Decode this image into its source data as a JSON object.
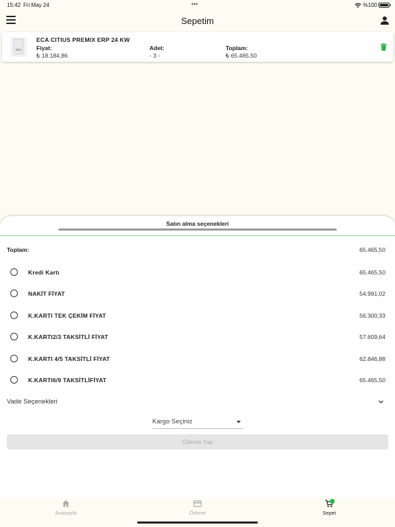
{
  "status_bar": {
    "time": "15:42",
    "date": "Fri May 24",
    "battery": "%100",
    "dots": "•••"
  },
  "header": {
    "title": "Sepetim"
  },
  "cart_item": {
    "name": "ECA CITIUS PREMIX ERP 24 KW",
    "price_label": "Fiyat:",
    "price_value": "₺ 18.184,86",
    "qty_label": "Adet:",
    "qty_value": "- 3 -",
    "total_label": "Toplam:",
    "total_value": "₺ 65.465,50"
  },
  "sheet": {
    "title": "Satın alma seçenekleri",
    "total_label": "Toplam:",
    "total_value": "65.465,50",
    "options": [
      {
        "name": "Kredi Kartı",
        "value": "65.465,50"
      },
      {
        "name": "NAKİT FİYAT",
        "value": "54.991,02"
      },
      {
        "name": "K.KARTI TEK ÇEKİM FİYAT",
        "value": "56.300,33"
      },
      {
        "name": "K.KARTI2/3 TAKSİTLİ FİYAT",
        "value": "57.609,64"
      },
      {
        "name": "K.KARTI 4/5 TAKSİTLİ FİYAT",
        "value": "62.846,88"
      },
      {
        "name": "K.KARTI6/9 TAKSİTLİFİYAT",
        "value": "65.465,50"
      }
    ],
    "vade_label": "Vade Seçenekleri",
    "kargo_label": "Kargo Seçiniz",
    "pay_button": "Ödeme Yap"
  },
  "nav": {
    "home": "Anasayfa",
    "payment": "Ödeme",
    "cart": "Sepet"
  },
  "colors": {
    "background": "#fcfcf3",
    "accent_green": "#2db34a",
    "divider_green": "#8fcb8f"
  }
}
